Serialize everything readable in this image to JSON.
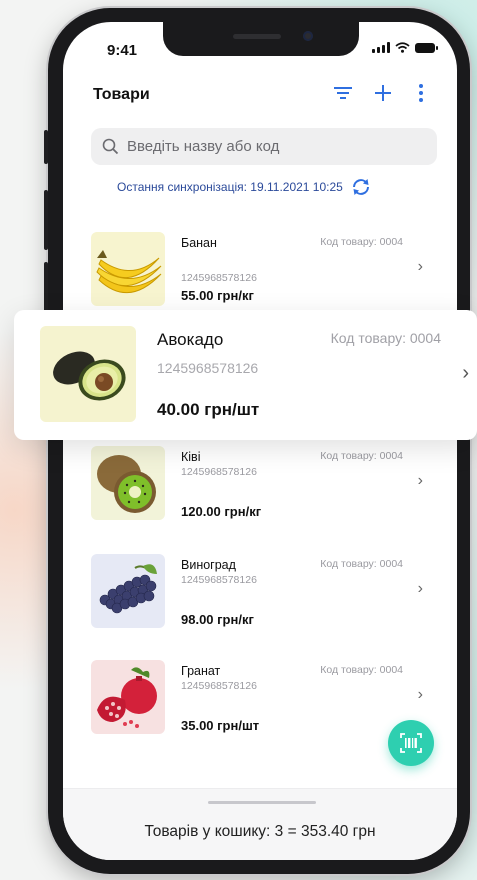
{
  "status": {
    "time": "9:41"
  },
  "header": {
    "title": "Товари"
  },
  "search": {
    "placeholder": "Введіть назву або код"
  },
  "sync": {
    "text": "Остання синхронізація: 19.11.2021 10:25"
  },
  "products": [
    {
      "name": "Банан",
      "code": "Код товару: 0004",
      "barcode": "1245968578126",
      "price": "55.00 грн/кг",
      "icon": "banana"
    },
    {
      "name": "Авокадо",
      "code": "Код товару: 0004",
      "barcode": "1245968578126",
      "price": "40.00 грн/шт",
      "icon": "avocado"
    },
    {
      "name": "Ківі",
      "code": "Код товару: 0004",
      "barcode": "1245968578126",
      "price": "120.00 грн/кг",
      "icon": "kiwi"
    },
    {
      "name": "Виноград",
      "code": "Код товару: 0004",
      "barcode": "1245968578126",
      "price": "98.00 грн/кг",
      "icon": "grapes"
    },
    {
      "name": "Гранат",
      "code": "Код товару: 0004",
      "barcode": "1245968578126",
      "price": "35.00 грн/шт",
      "icon": "pomegranate"
    }
  ],
  "cart": {
    "summary": "Товарів у кошику: 3 = 353.40 грн"
  },
  "colors": {
    "accent": "#2f6fe0",
    "fab": "#2ecfb0",
    "sync": "#2b4a9a"
  }
}
